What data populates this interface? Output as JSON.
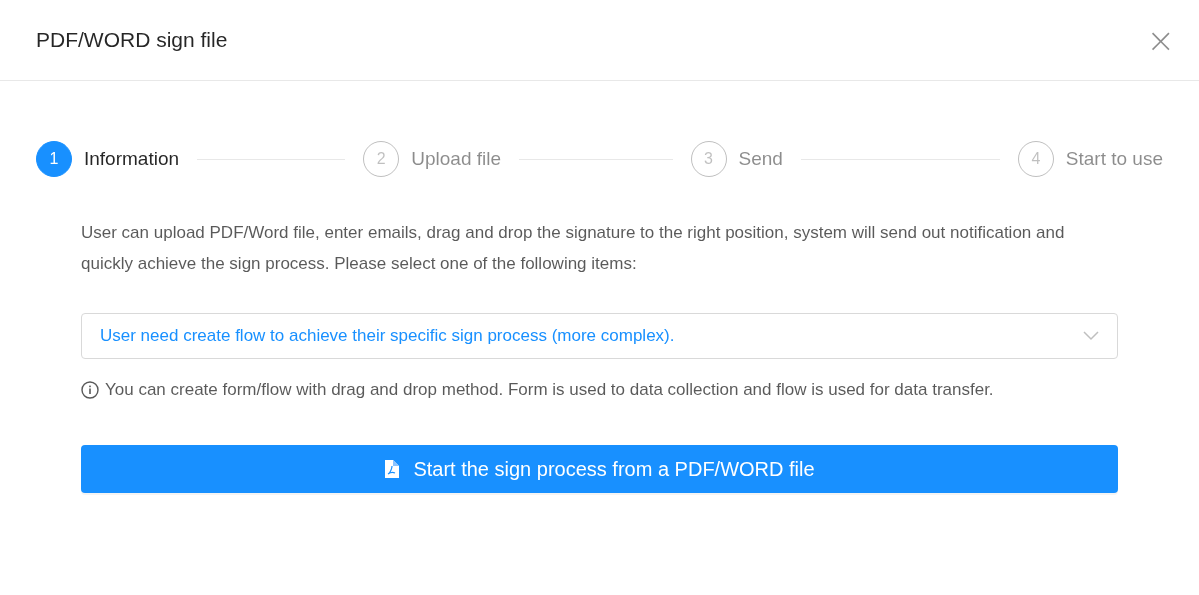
{
  "dialog": {
    "title": "PDF/WORD sign file",
    "close": "×"
  },
  "steps": [
    {
      "number": "1",
      "label": "Information",
      "selected": true
    },
    {
      "number": "2",
      "label": "Upload file",
      "selected": false
    },
    {
      "number": "3",
      "label": "Send",
      "selected": false
    },
    {
      "number": "4",
      "label": "Start to use",
      "selected": false
    }
  ],
  "description": "User can upload PDF/Word file, enter emails, drag and drop the signature to the right position, system will send out notification and quickly achieve the sign process. Please select one of the following items:",
  "select": {
    "value": "User need create flow to achieve their specific sign process (more complex)."
  },
  "hint": "You can create form/flow with drag and drop method. Form is used to data collection and flow is used for data transfer.",
  "button": {
    "label": "Start the sign process from a PDF/WORD file"
  }
}
